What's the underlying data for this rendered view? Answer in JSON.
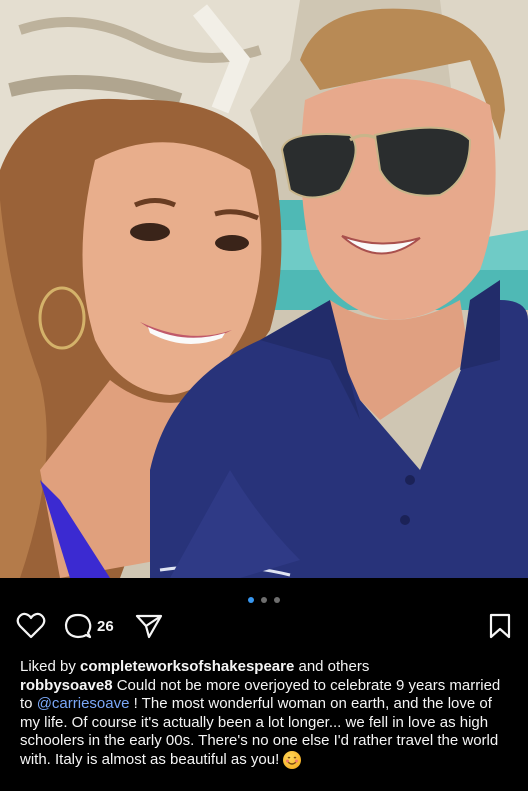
{
  "post": {
    "pagination": {
      "count": 3,
      "active": 0
    },
    "actions": {
      "like_icon": "heart-icon",
      "comment_icon": "comment-icon",
      "comment_count": "26",
      "share_icon": "send-icon",
      "save_icon": "bookmark-icon"
    },
    "likes": {
      "prefix": "Liked by ",
      "user": "completeworksofshakespeare",
      "suffix": " and others"
    },
    "caption": {
      "username": "robbysoave8",
      "text_before": " Could not be more overjoyed to celebrate 9 years married to ",
      "mention": "@carriesoave",
      "text_after": " ! The most wonderful woman on earth, and the love of my life. Of course it's actually been a lot longer... we fell in love as high schoolers in the early 00s. There's no one else I'd rather travel the world with. Italy is almost as beautiful as you! ",
      "emoji_icon": "smiling-face-emoji"
    },
    "colors": {
      "background": "#000000",
      "accent": "#3897f0",
      "mention": "#7aa7f7"
    }
  }
}
